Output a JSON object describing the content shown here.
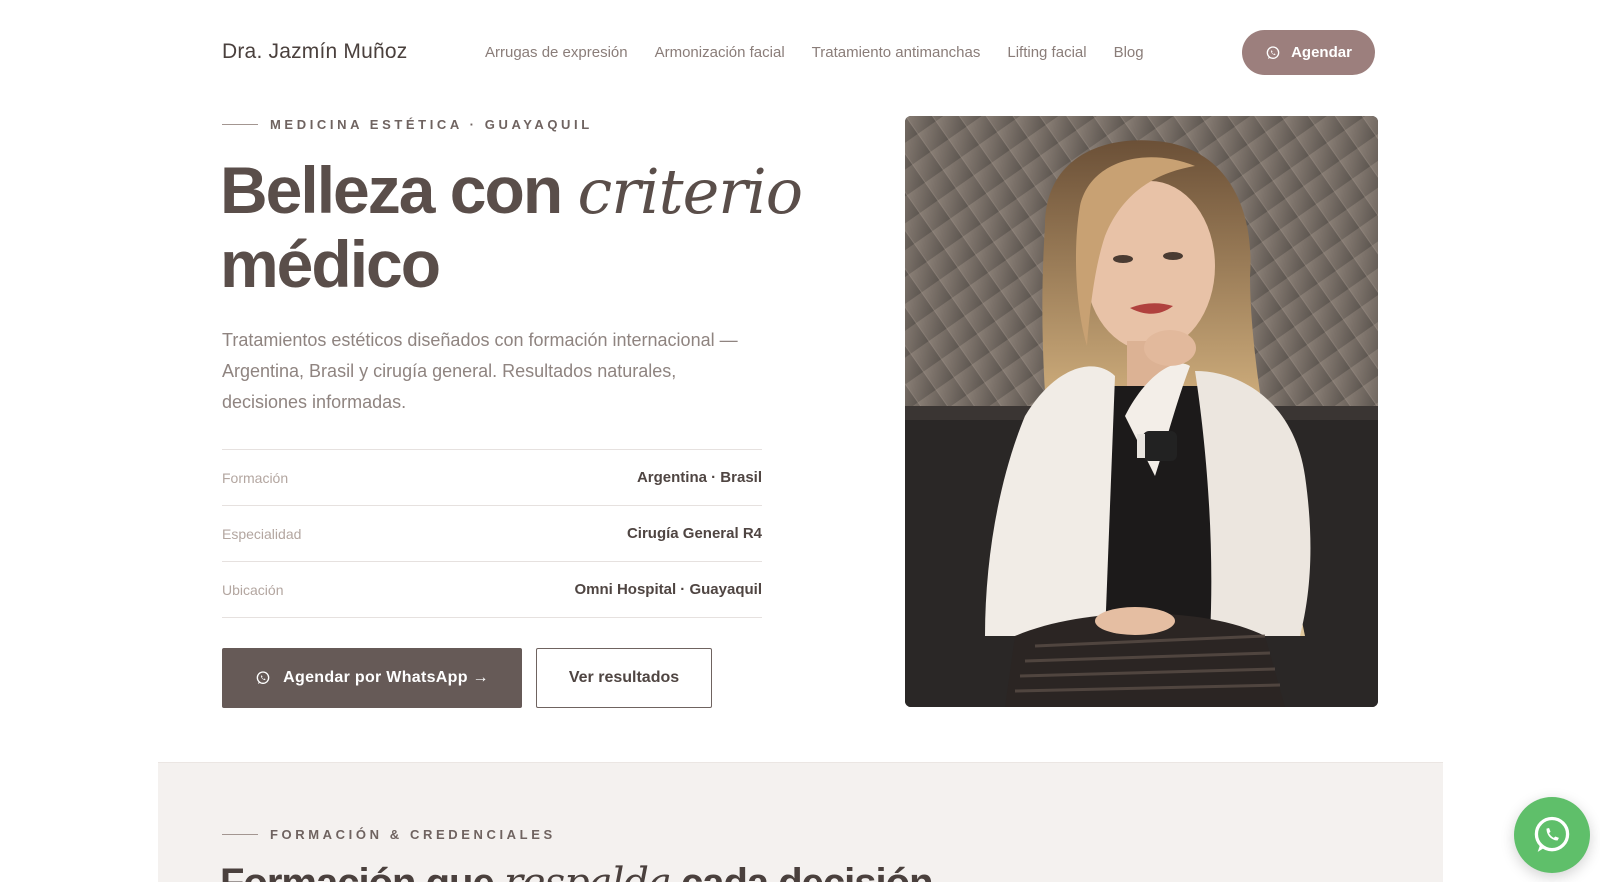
{
  "header": {
    "brand": "Dra. Jazmín Muñoz",
    "nav": [
      "Arrugas de expresión",
      "Armonización facial",
      "Tratamiento antimanchas",
      "Lifting facial",
      "Blog"
    ],
    "cta_label": "Agendar",
    "cta_icon": "whatsapp-icon"
  },
  "hero": {
    "eyebrow": "MEDICINA ESTÉTICA · GUAYAQUIL",
    "title_part1": "Belleza con ",
    "title_emphasis": "criterio",
    "title_part2": "médico",
    "lead": "Tratamientos estéticos diseñados con formación internacional — Argentina, Brasil y cirugía general. Resultados naturales, decisiones informadas.",
    "facts": [
      {
        "label": "Formación",
        "value": "Argentina · Brasil"
      },
      {
        "label": "Especialidad",
        "value": "Cirugía General R4"
      },
      {
        "label": "Ubicación",
        "value": "Omni Hospital · Guayaquil"
      }
    ],
    "primary_cta": "Agendar por WhatsApp →",
    "secondary_cta": "Ver resultados"
  },
  "credentials": {
    "eyebrow": "FORMACIÓN & CREDENCIALES",
    "title_part1": "Formación que ",
    "title_emphasis": "respalda",
    "title_part2": " cada decisión"
  },
  "colors": {
    "accent": "#9c7f7d",
    "primary_dark": "#665a57",
    "band_bg": "#f4f1ef",
    "whatsapp": "#5fbf6a"
  }
}
